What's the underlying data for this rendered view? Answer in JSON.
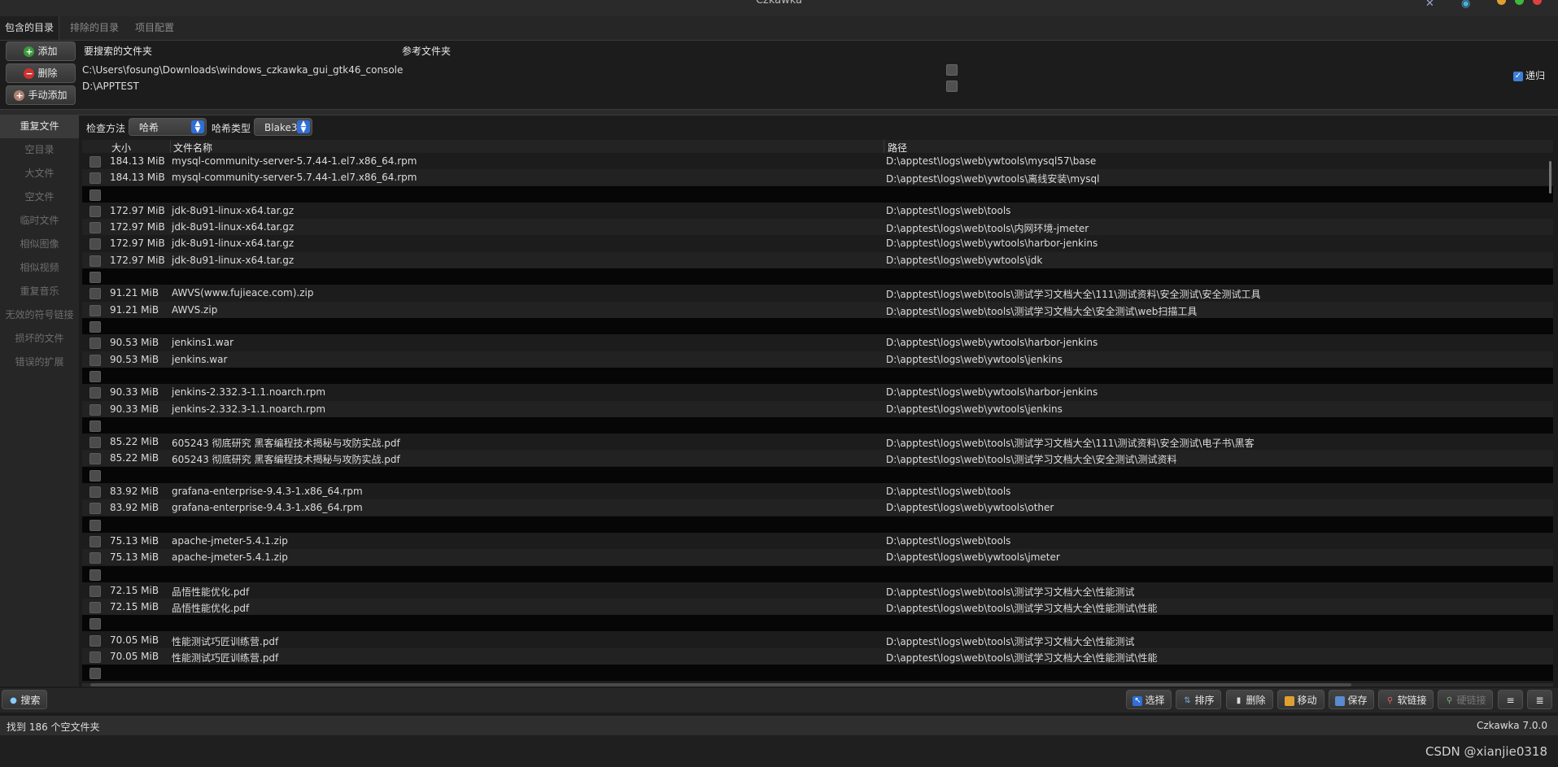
{
  "window": {
    "title": "Czkawka"
  },
  "tabs": [
    {
      "label": "包含的目录"
    },
    {
      "label": "排除的目录"
    },
    {
      "label": "项目配置"
    }
  ],
  "top_buttons": {
    "add": "添加",
    "remove": "删除",
    "manual_add": "手动添加"
  },
  "dirs": {
    "col_search": "要搜索的文件夹",
    "col_reference": "参考文件夹",
    "items": [
      "C:\\Users\\fosung\\Downloads\\windows_czkawka_gui_gtk46_console",
      "D:\\APPTEST"
    ],
    "recurse_label": "递归"
  },
  "sidebar": {
    "items": [
      {
        "label": "重复文件"
      },
      {
        "label": "空目录"
      },
      {
        "label": "大文件"
      },
      {
        "label": "空文件"
      },
      {
        "label": "临时文件"
      },
      {
        "label": "相似图像"
      },
      {
        "label": "相似视频"
      },
      {
        "label": "重复音乐"
      },
      {
        "label": "无效的符号链接"
      },
      {
        "label": "损坏的文件"
      },
      {
        "label": "错误的扩展"
      }
    ]
  },
  "method": {
    "label": "检查方法",
    "value": "哈希",
    "hash_label": "哈希类型",
    "hash_value": "Blake3"
  },
  "results": {
    "headers": {
      "size": "大小",
      "name": "文件名称",
      "path": "路径"
    },
    "groups": [
      {
        "rows": [
          {
            "size": "184.13 MiB",
            "name": "mysql-community-server-5.7.44-1.el7.x86_64.rpm",
            "path": "D:\\apptest\\logs\\web\\ywtools\\mysql57\\base"
          },
          {
            "size": "184.13 MiB",
            "name": "mysql-community-server-5.7.44-1.el7.x86_64.rpm",
            "path": "D:\\apptest\\logs\\web\\ywtools\\离线安装\\mysql"
          }
        ]
      },
      {
        "rows": [
          {
            "size": "172.97 MiB",
            "name": "jdk-8u91-linux-x64.tar.gz",
            "path": "D:\\apptest\\logs\\web\\tools"
          },
          {
            "size": "172.97 MiB",
            "name": "jdk-8u91-linux-x64.tar.gz",
            "path": "D:\\apptest\\logs\\web\\tools\\内网环境-jmeter"
          },
          {
            "size": "172.97 MiB",
            "name": "jdk-8u91-linux-x64.tar.gz",
            "path": "D:\\apptest\\logs\\web\\ywtools\\harbor-jenkins"
          },
          {
            "size": "172.97 MiB",
            "name": "jdk-8u91-linux-x64.tar.gz",
            "path": "D:\\apptest\\logs\\web\\ywtools\\jdk"
          }
        ]
      },
      {
        "rows": [
          {
            "size": "91.21 MiB",
            "name": "AWVS(www.fujieace.com).zip",
            "path": "D:\\apptest\\logs\\web\\tools\\测试学习文档大全\\111\\测试资料\\安全测试\\安全测试工具"
          },
          {
            "size": "91.21 MiB",
            "name": "AWVS.zip",
            "path": "D:\\apptest\\logs\\web\\tools\\测试学习文档大全\\安全测试\\web扫描工具"
          }
        ]
      },
      {
        "rows": [
          {
            "size": "90.53 MiB",
            "name": "jenkins1.war",
            "path": "D:\\apptest\\logs\\web\\ywtools\\harbor-jenkins"
          },
          {
            "size": "90.53 MiB",
            "name": "jenkins.war",
            "path": "D:\\apptest\\logs\\web\\ywtools\\jenkins"
          }
        ]
      },
      {
        "rows": [
          {
            "size": "90.33 MiB",
            "name": "jenkins-2.332.3-1.1.noarch.rpm",
            "path": "D:\\apptest\\logs\\web\\ywtools\\harbor-jenkins"
          },
          {
            "size": "90.33 MiB",
            "name": "jenkins-2.332.3-1.1.noarch.rpm",
            "path": "D:\\apptest\\logs\\web\\ywtools\\jenkins"
          }
        ]
      },
      {
        "rows": [
          {
            "size": "85.22 MiB",
            "name": "605243 彻底研究  黑客编程技术揭秘与攻防实战.pdf",
            "path": "D:\\apptest\\logs\\web\\tools\\测试学习文档大全\\111\\测试资料\\安全测试\\电子书\\黑客"
          },
          {
            "size": "85.22 MiB",
            "name": "605243 彻底研究  黑客编程技术揭秘与攻防实战.pdf",
            "path": "D:\\apptest\\logs\\web\\tools\\测试学习文档大全\\安全测试\\测试资料"
          }
        ]
      },
      {
        "rows": [
          {
            "size": "83.92 MiB",
            "name": "grafana-enterprise-9.4.3-1.x86_64.rpm",
            "path": "D:\\apptest\\logs\\web\\tools"
          },
          {
            "size": "83.92 MiB",
            "name": "grafana-enterprise-9.4.3-1.x86_64.rpm",
            "path": "D:\\apptest\\logs\\web\\ywtools\\other"
          }
        ]
      },
      {
        "rows": [
          {
            "size": "75.13 MiB",
            "name": "apache-jmeter-5.4.1.zip",
            "path": "D:\\apptest\\logs\\web\\tools"
          },
          {
            "size": "75.13 MiB",
            "name": "apache-jmeter-5.4.1.zip",
            "path": "D:\\apptest\\logs\\web\\ywtools\\jmeter"
          }
        ]
      },
      {
        "rows": [
          {
            "size": "72.15 MiB",
            "name": "品悟性能优化.pdf",
            "path": "D:\\apptest\\logs\\web\\tools\\测试学习文档大全\\性能测试"
          },
          {
            "size": "72.15 MiB",
            "name": "品悟性能优化.pdf",
            "path": "D:\\apptest\\logs\\web\\tools\\测试学习文档大全\\性能测试\\性能"
          }
        ]
      },
      {
        "rows": [
          {
            "size": "70.05 MiB",
            "name": "性能测试巧匠训练营.pdf",
            "path": "D:\\apptest\\logs\\web\\tools\\测试学习文档大全\\性能测试"
          },
          {
            "size": "70.05 MiB",
            "name": "性能测试巧匠训练营.pdf",
            "path": "D:\\apptest\\logs\\web\\tools\\测试学习文档大全\\性能测试\\性能"
          }
        ]
      }
    ]
  },
  "bottom": {
    "search": "搜索",
    "select": "选择",
    "sort": "排序",
    "delete": "删除",
    "move": "移动",
    "save": "保存",
    "symlink": "软链接",
    "hardlink": "硬链接"
  },
  "status": {
    "left": "找到 186 个空文件夹",
    "right": "Czkawka 7.0.0"
  },
  "watermark": "CSDN @xianjie0318",
  "colors": {
    "accent": "#2f6fd6",
    "background": "#1c1c1c",
    "group_separator": "#060606"
  },
  "icons": {
    "add": "plus-circle-icon",
    "remove": "minus-circle-icon",
    "manual_add": "plus-circle-icon",
    "search": "magnifier-icon",
    "select": "cursor-icon",
    "sort": "sort-icon",
    "delete": "trash-icon",
    "move": "folder-icon",
    "save": "floppy-icon",
    "symlink": "link-icon",
    "hardlink": "link-icon"
  }
}
